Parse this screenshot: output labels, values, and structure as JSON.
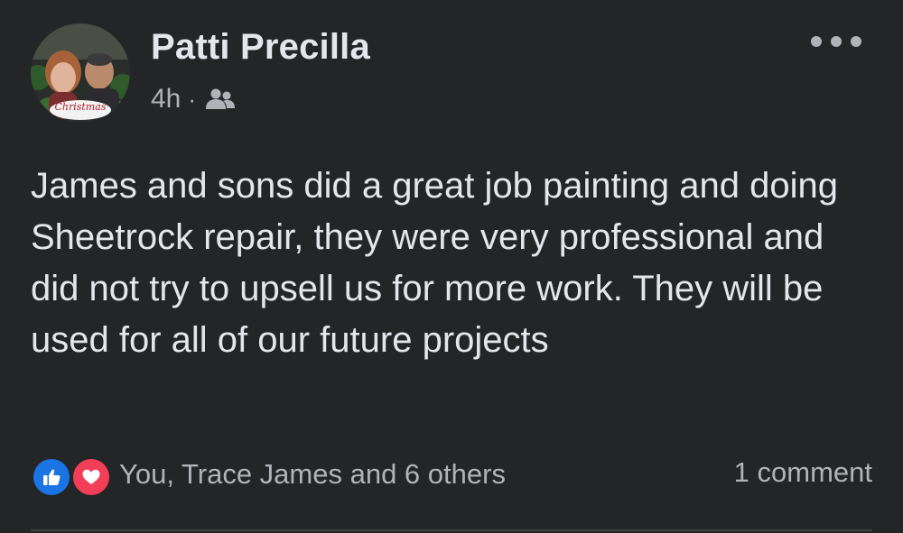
{
  "post": {
    "author": "Patti Precilla",
    "time": "4h",
    "separator": "·",
    "audience_icon": "group-icon",
    "avatar_caption": "Christmas",
    "text": "James and sons did a great job painting and doing Sheetrock repair, they were very professional and did not try to upsell us for more work. They will be used for all of our future projects",
    "reactions": {
      "icons": [
        "like-icon",
        "love-icon"
      ],
      "summary": "You, Trace James and 6 others"
    },
    "comments_label": "1 comment",
    "more_icon": "more-options-icon"
  },
  "colors": {
    "background": "#242526",
    "primary_text": "#e4e6eb",
    "secondary_text": "#b0b3b8",
    "like_blue": "#1b74e4",
    "love_red": "#f33e58"
  }
}
